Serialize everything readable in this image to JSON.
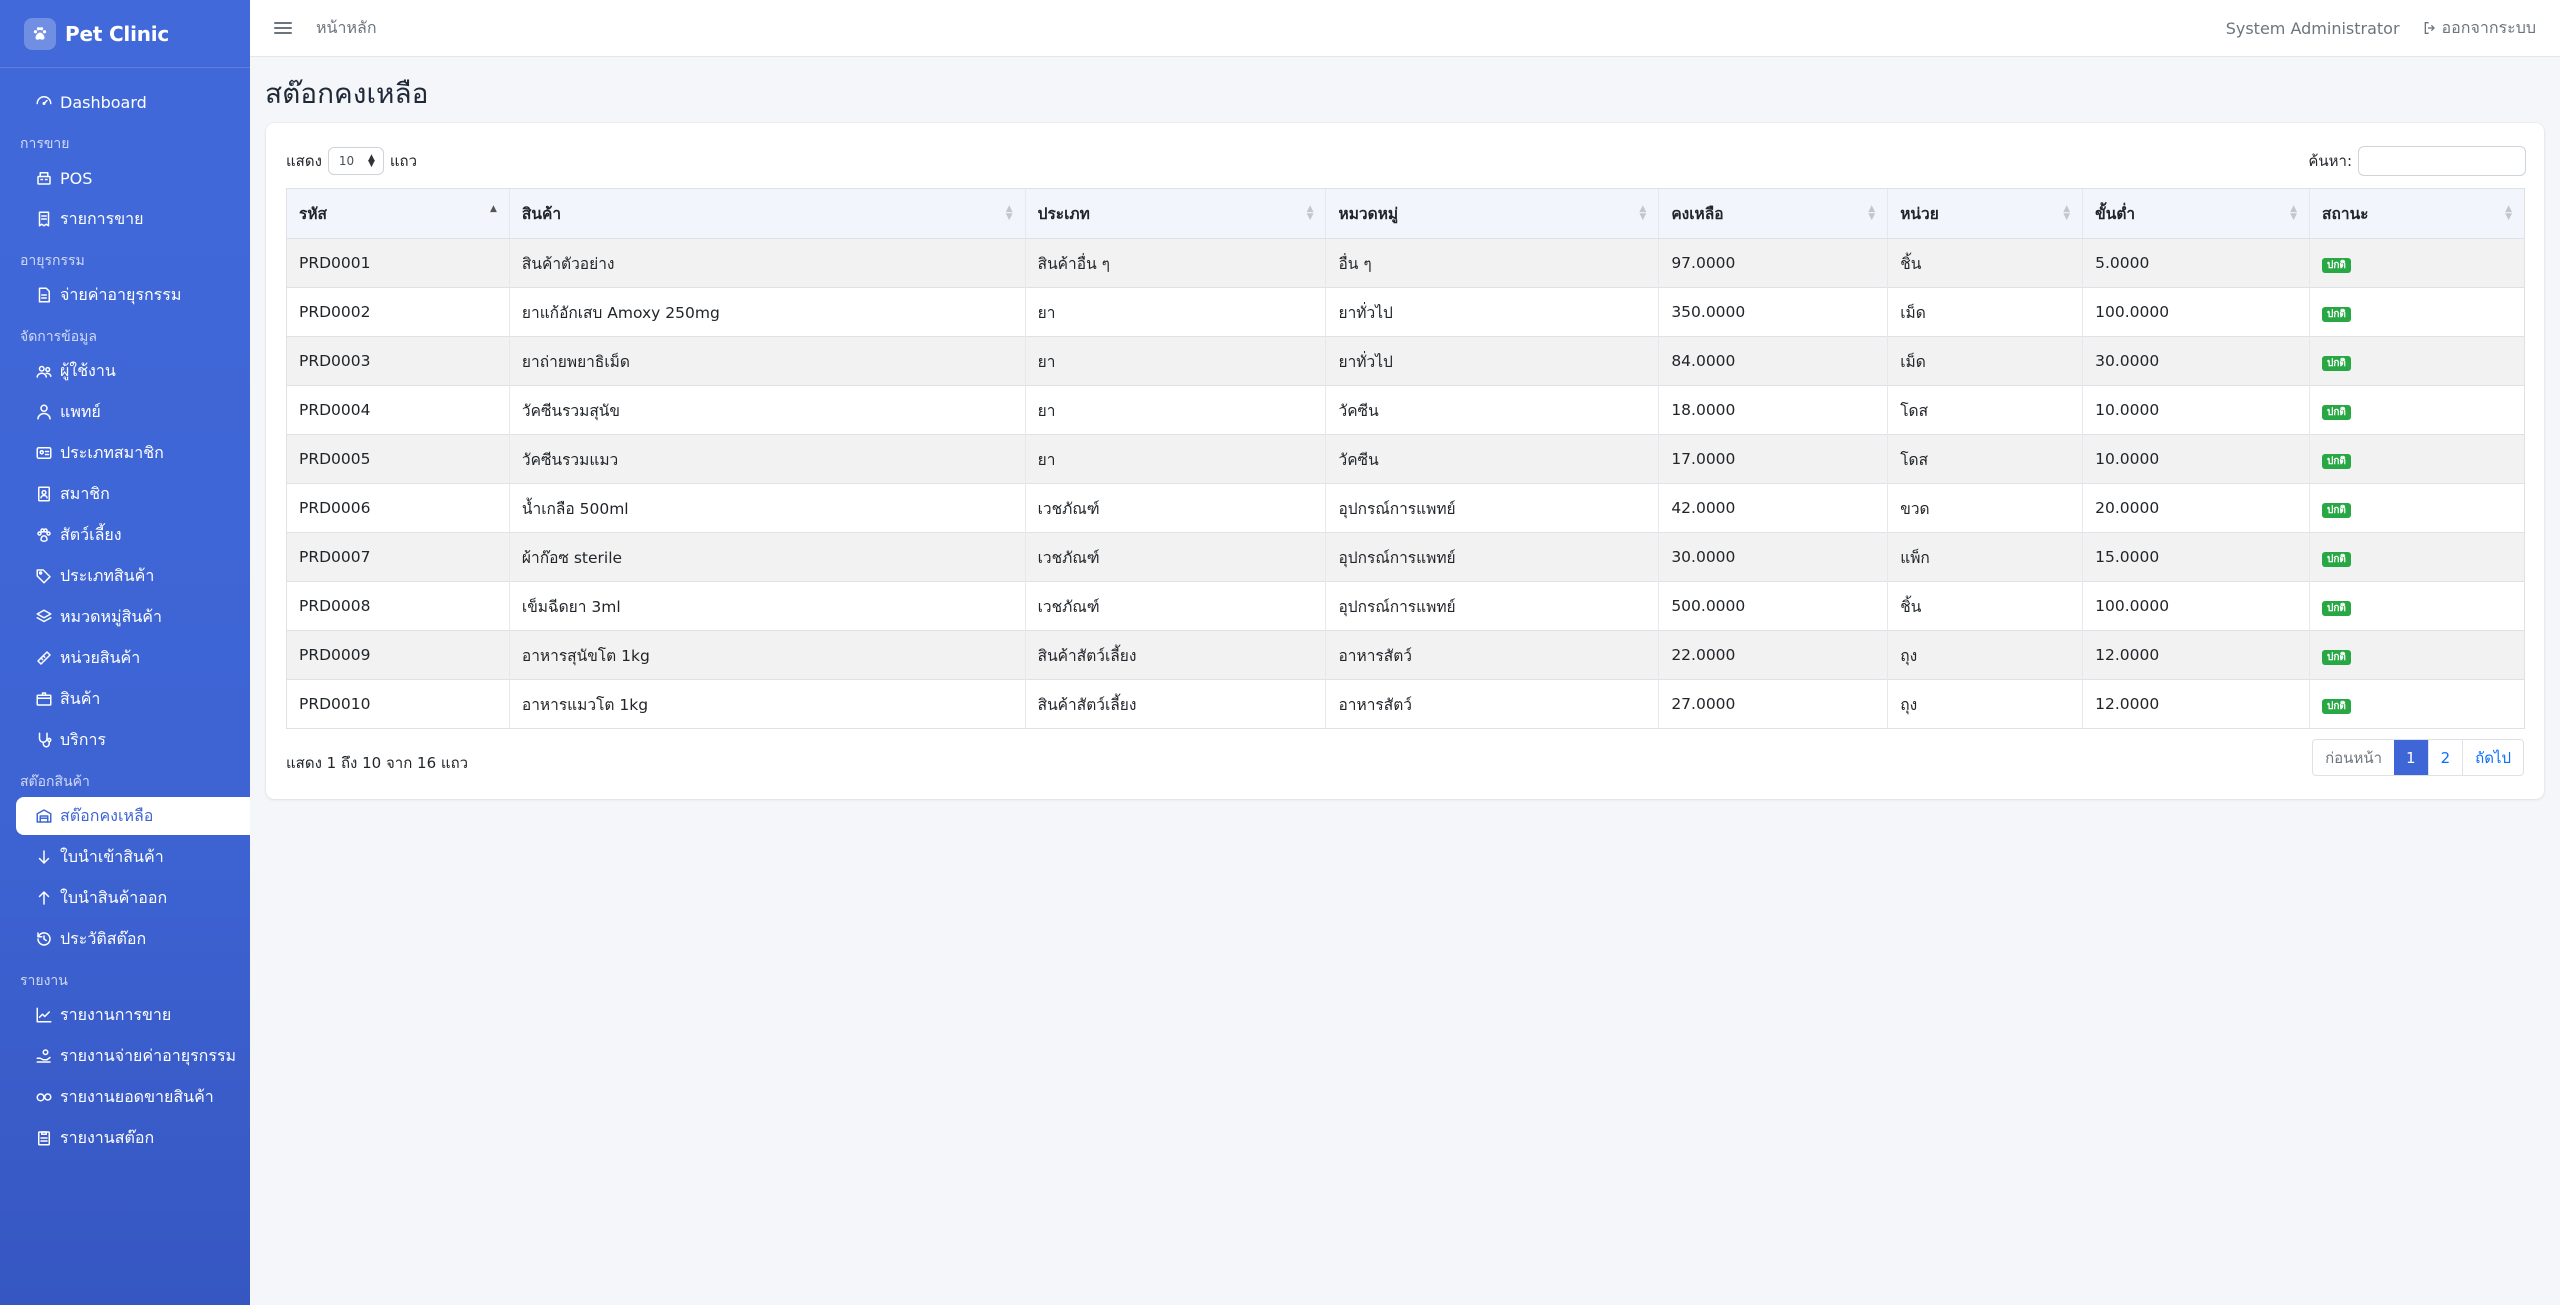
{
  "brand": {
    "title": "Pet Clinic"
  },
  "sidebar": {
    "groups": [
      {
        "header": "",
        "items": [
          {
            "label": "Dashboard",
            "icon": "dashboard-icon"
          }
        ]
      },
      {
        "header": "การขาย",
        "items": [
          {
            "label": "POS",
            "icon": "cash-register-icon"
          },
          {
            "label": "รายการขาย",
            "icon": "receipt-icon"
          }
        ]
      },
      {
        "header": "อายุรกรรม",
        "items": [
          {
            "label": "จ่ายค่าอายุรกรรม",
            "icon": "invoice-icon"
          }
        ]
      },
      {
        "header": "จัดการข้อมูล",
        "items": [
          {
            "label": "ผู้ใช้งาน",
            "icon": "users-icon"
          },
          {
            "label": "แพทย์",
            "icon": "doctor-icon"
          },
          {
            "label": "ประเภทสมาชิก",
            "icon": "id-card-icon"
          },
          {
            "label": "สมาชิก",
            "icon": "member-icon"
          },
          {
            "label": "สัตว์เลี้ยง",
            "icon": "paw-icon"
          },
          {
            "label": "ประเภทสินค้า",
            "icon": "tags-icon"
          },
          {
            "label": "หมวดหมู่สินค้า",
            "icon": "layers-icon"
          },
          {
            "label": "หน่วยสินค้า",
            "icon": "ruler-icon"
          },
          {
            "label": "สินค้า",
            "icon": "box-icon"
          },
          {
            "label": "บริการ",
            "icon": "stethoscope-icon"
          }
        ]
      },
      {
        "header": "สต๊อกสินค้า",
        "items": [
          {
            "label": "สต๊อกคงเหลือ",
            "icon": "warehouse-icon",
            "active": true
          },
          {
            "label": "ใบนำเข้าสินค้า",
            "icon": "arrow-down-icon"
          },
          {
            "label": "ใบนำสินค้าออก",
            "icon": "arrow-up-icon"
          },
          {
            "label": "ประวัติสต๊อก",
            "icon": "history-icon"
          }
        ]
      },
      {
        "header": "รายงาน",
        "items": [
          {
            "label": "รายงานการขาย",
            "icon": "chart-line-icon"
          },
          {
            "label": "รายงานจ่ายค่าอายุรกรรม",
            "icon": "hand-coin-icon"
          },
          {
            "label": "รายงานยอดขายสินค้า",
            "icon": "pills-icon"
          },
          {
            "label": "รายงานสต๊อก",
            "icon": "clipboard-icon"
          }
        ]
      }
    ]
  },
  "topbar": {
    "breadcrumb": "หน้าหลัก",
    "user": "System Administrator",
    "logout": "ออกจากระบบ"
  },
  "page": {
    "title": "สต๊อกคงเหลือ"
  },
  "table_controls": {
    "show_prefix": "แสดง",
    "page_length": "10",
    "show_suffix": "แถว",
    "search_label": "ค้นหา:",
    "search_value": ""
  },
  "table": {
    "columns": [
      "รหัส",
      "สินค้า",
      "ประเภท",
      "หมวดหมู่",
      "คงเหลือ",
      "หน่วย",
      "ขั้นต่ำ",
      "สถานะ"
    ],
    "rows": [
      [
        "PRD0001",
        "สินค้าตัวอย่าง",
        "สินค้าอื่น ๆ",
        "อื่น ๆ",
        "97.0000",
        "ชิ้น",
        "5.0000",
        "ปกติ"
      ],
      [
        "PRD0002",
        "ยาแก้อักเสบ Amoxy 250mg",
        "ยา",
        "ยาทั่วไป",
        "350.0000",
        "เม็ด",
        "100.0000",
        "ปกติ"
      ],
      [
        "PRD0003",
        "ยาถ่ายพยาธิเม็ด",
        "ยา",
        "ยาทั่วไป",
        "84.0000",
        "เม็ด",
        "30.0000",
        "ปกติ"
      ],
      [
        "PRD0004",
        "วัคซีนรวมสุนัข",
        "ยา",
        "วัคซีน",
        "18.0000",
        "โดส",
        "10.0000",
        "ปกติ"
      ],
      [
        "PRD0005",
        "วัคซีนรวมแมว",
        "ยา",
        "วัคซีน",
        "17.0000",
        "โดส",
        "10.0000",
        "ปกติ"
      ],
      [
        "PRD0006",
        "น้ำเกลือ 500ml",
        "เวชภัณฑ์",
        "อุปกรณ์การแพทย์",
        "42.0000",
        "ขวด",
        "20.0000",
        "ปกติ"
      ],
      [
        "PRD0007",
        "ผ้าก๊อซ sterile",
        "เวชภัณฑ์",
        "อุปกรณ์การแพทย์",
        "30.0000",
        "แพ็ก",
        "15.0000",
        "ปกติ"
      ],
      [
        "PRD0008",
        "เข็มฉีดยา 3ml",
        "เวชภัณฑ์",
        "อุปกรณ์การแพทย์",
        "500.0000",
        "ชิ้น",
        "100.0000",
        "ปกติ"
      ],
      [
        "PRD0009",
        "อาหารสุนัขโต 1kg",
        "สินค้าสัตว์เลี้ยง",
        "อาหารสัตว์",
        "22.0000",
        "ถุง",
        "12.0000",
        "ปกติ"
      ],
      [
        "PRD0010",
        "อาหารแมวโต 1kg",
        "สินค้าสัตว์เลี้ยง",
        "อาหารสัตว์",
        "27.0000",
        "ถุง",
        "12.0000",
        "ปกติ"
      ]
    ],
    "status_color": "#28a745"
  },
  "footer": {
    "info": "แสดง 1 ถึง 10 จาก 16 แถว",
    "pagination": {
      "prev": "ก่อนหน้า",
      "pages": [
        "1",
        "2"
      ],
      "current": "1",
      "next": "ถัดไป"
    }
  },
  "colors": {
    "sidebar": "#3f66d6",
    "accent": "#3f66d6",
    "background": "#f4f6f9"
  }
}
